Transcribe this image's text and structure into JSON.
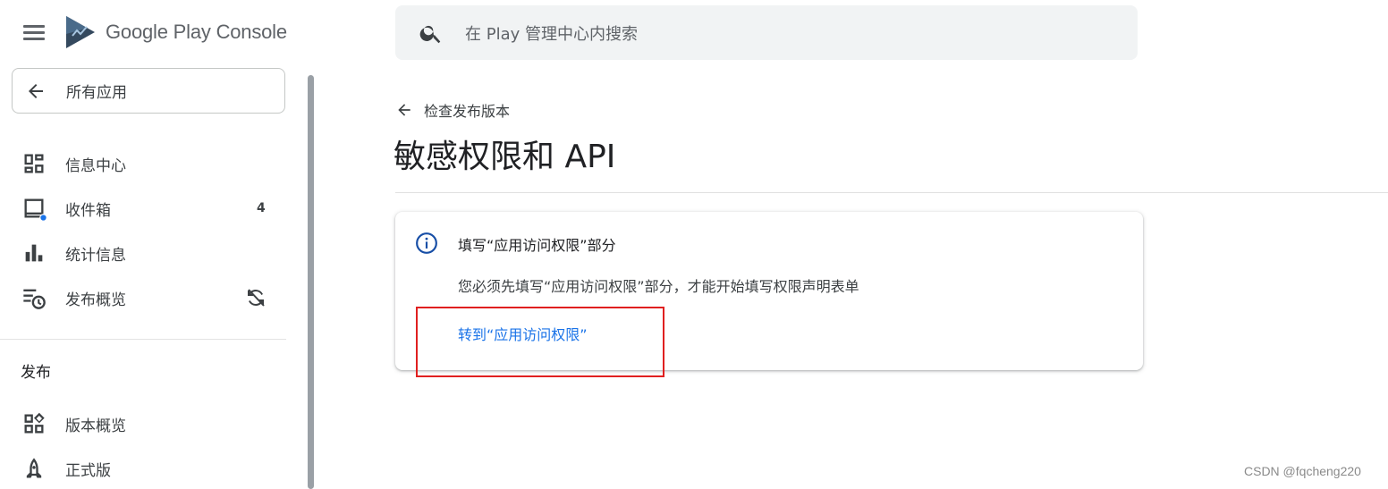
{
  "app": {
    "logo_text": "Google Play Console"
  },
  "sidebar": {
    "back_button_label": "所有应用",
    "items": [
      {
        "label": "信息中心",
        "icon": "dashboard-icon"
      },
      {
        "label": "收件箱",
        "icon": "inbox-icon",
        "count": "4"
      },
      {
        "label": "统计信息",
        "icon": "bar-chart-icon"
      },
      {
        "label": "发布概览",
        "icon": "publishing-overview-icon",
        "trailing_icon": "sync-disabled-icon"
      }
    ],
    "section_title": "发布",
    "section_items": [
      {
        "label": "版本概览",
        "icon": "release-overview-icon"
      },
      {
        "label": "正式版",
        "icon": "production-icon"
      }
    ]
  },
  "search": {
    "placeholder": "在 Play 管理中心内搜索"
  },
  "breadcrumb": {
    "back_label": "检查发布版本"
  },
  "page": {
    "title": "敏感权限和 API"
  },
  "card": {
    "title": "填写“应用访问权限”部分",
    "body": "您必须先填写“应用访问权限”部分，才能开始填写权限声明表单",
    "link": "转到“应用访问权限”"
  },
  "watermark": "CSDN @fqcheng220",
  "colors": {
    "link": "#1a73e8",
    "highlight_box": "#e02020",
    "badge_dot": "#1a73e8"
  }
}
